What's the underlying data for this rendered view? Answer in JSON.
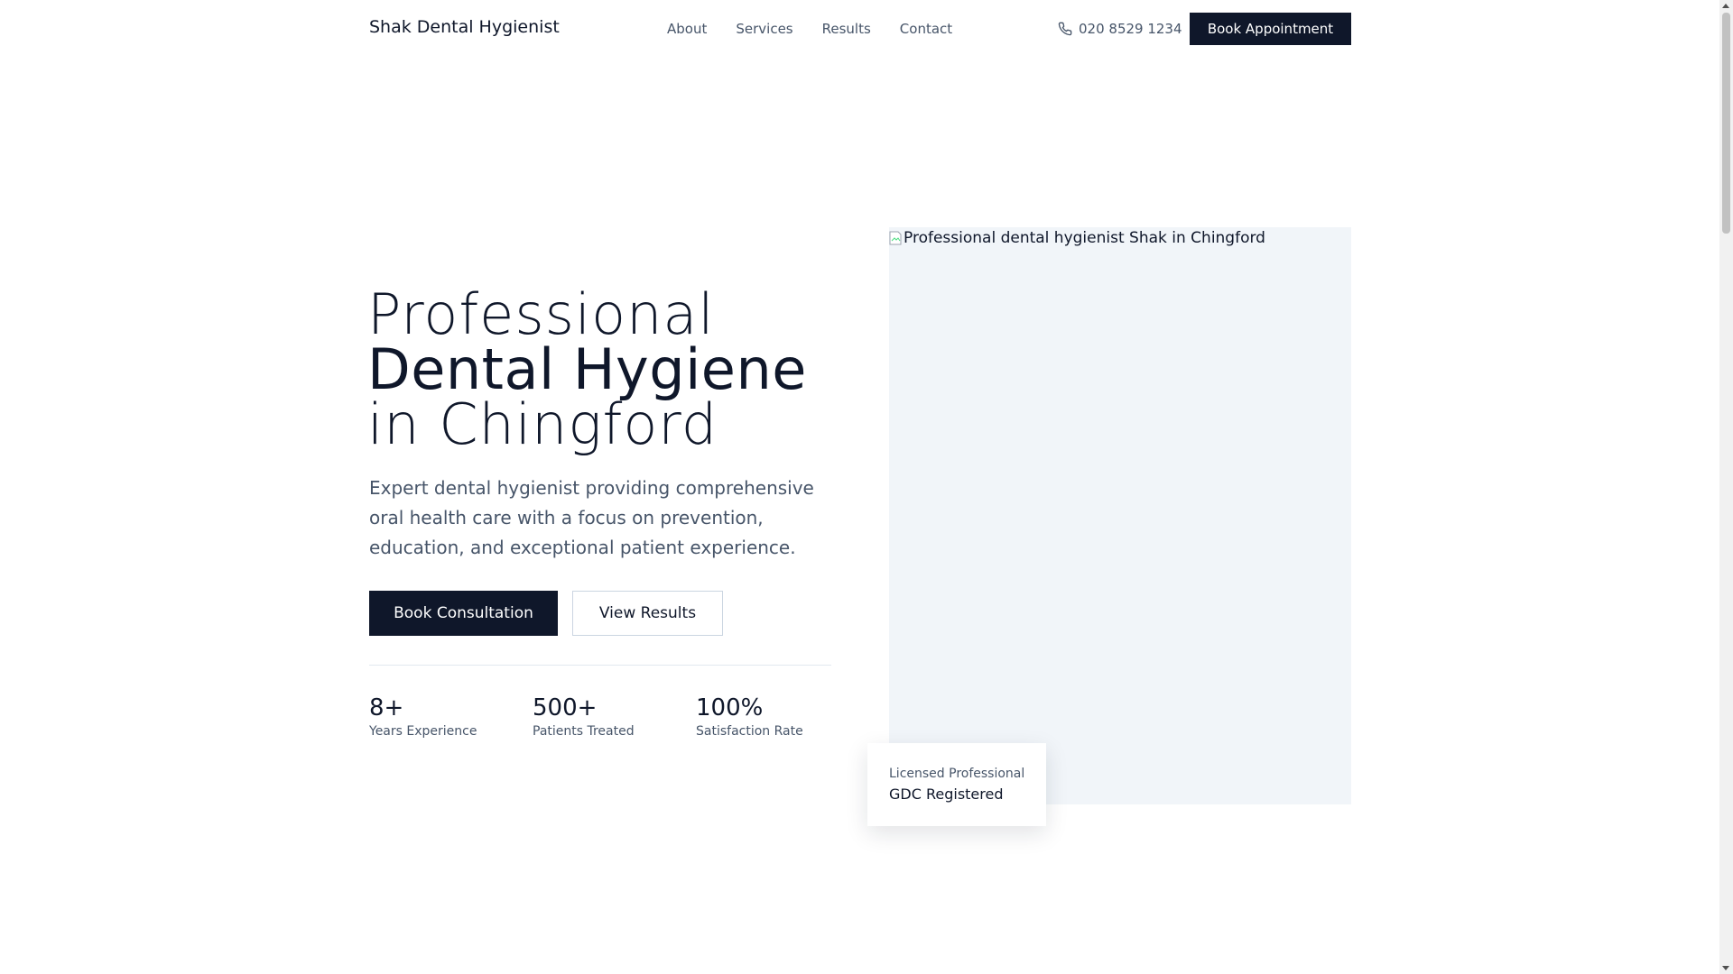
{
  "header": {
    "brand": "Shak Dental Hygienist",
    "nav": [
      {
        "label": "About"
      },
      {
        "label": "Services"
      },
      {
        "label": "Results"
      },
      {
        "label": "Contact"
      }
    ],
    "phone": "020 8529 1234",
    "phone_icon": "phone-icon",
    "book_button": "Book Appointment"
  },
  "hero": {
    "title_line1": "Professional",
    "title_line2": "Dental Hygiene",
    "title_line3": "in Chingford",
    "description": "Expert dental hygienist providing comprehensive oral health care with a focus on prevention, education, and exceptional patient experience.",
    "primary_button": "Book Consultation",
    "secondary_button": "View Results",
    "stats": [
      {
        "value": "8+",
        "label": "Years Experience"
      },
      {
        "value": "500+",
        "label": "Patients Treated"
      },
      {
        "value": "100%",
        "label": "Satisfaction Rate"
      }
    ],
    "image_alt": "Professional dental hygienist Shak in Chingford",
    "badge": {
      "small": "Licensed Professional",
      "main": "GDC Registered"
    }
  },
  "colors": {
    "primary": "#0f172a",
    "muted_text": "#475569",
    "image_placeholder": "#f1f5f9"
  }
}
